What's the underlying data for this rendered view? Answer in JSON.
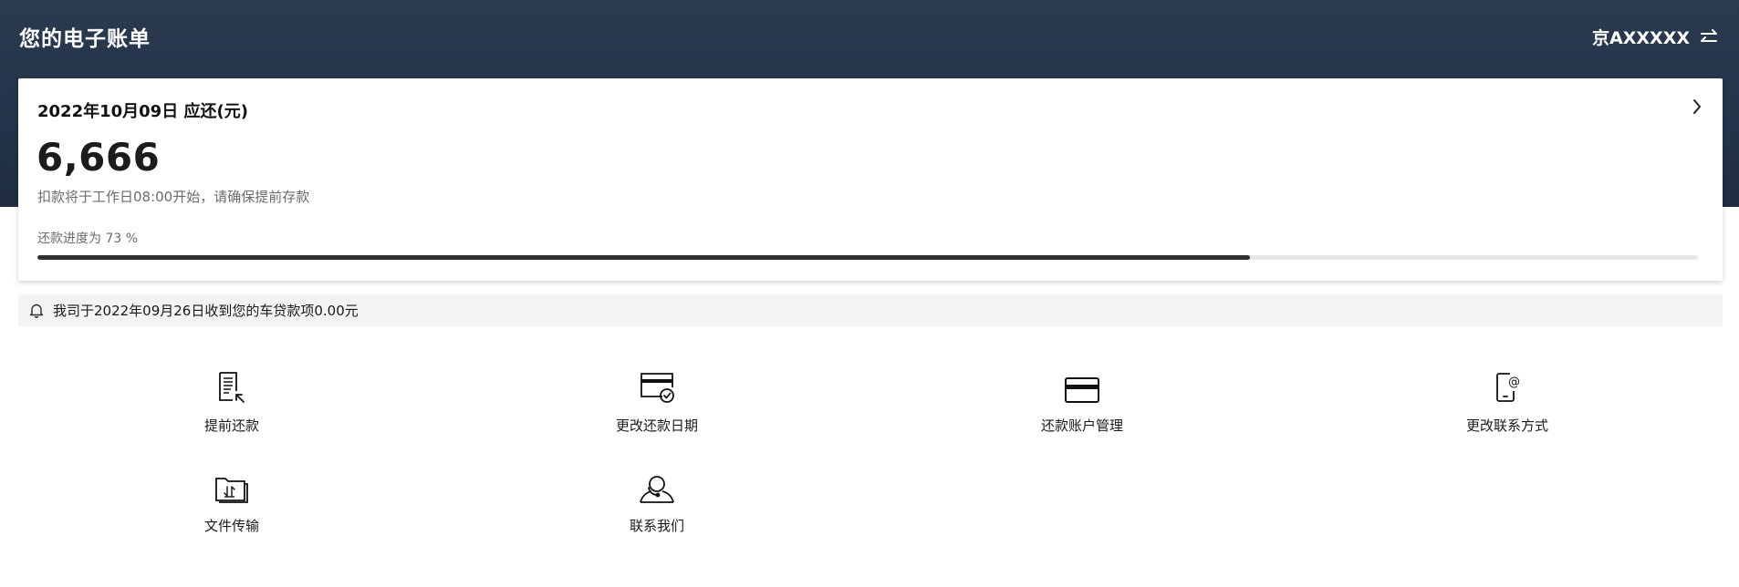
{
  "header": {
    "title": "您的电子账单",
    "plate": "京AXXXXX"
  },
  "bill": {
    "due_line": "2022年10月09日 应还(元)",
    "amount": "6,666",
    "deduct_note": "扣款将于工作日08:00开始，请确保提前存款",
    "progress_label": "还款进度为 73 %",
    "progress": 0.73
  },
  "notice": {
    "text": "我司于2022年09月26日收到您的车贷款项0.00元"
  },
  "actions": [
    {
      "label": "提前还款",
      "icon": "document-arrow-icon"
    },
    {
      "label": "更改还款日期",
      "icon": "card-clock-icon"
    },
    {
      "label": "还款账户管理",
      "icon": "credit-card-icon"
    },
    {
      "label": "更改联系方式",
      "icon": "phone-at-icon"
    },
    {
      "label": "文件传输",
      "icon": "folder-transfer-icon"
    },
    {
      "label": "联系我们",
      "icon": "customer-service-icon"
    }
  ]
}
